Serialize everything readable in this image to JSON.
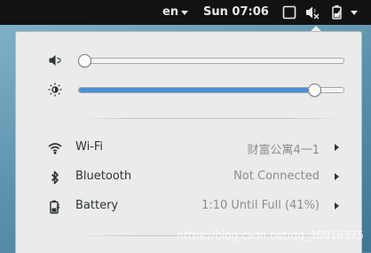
{
  "topbar": {
    "language": "en",
    "clock": "Sun 07:06",
    "icons": [
      "screen-icon",
      "volume-muted-icon",
      "battery-charging-icon",
      "chevron-down-icon"
    ]
  },
  "menu": {
    "volume": {
      "icon": "volume-muted-icon",
      "level": 0.0
    },
    "brightness": {
      "icon": "brightness-icon",
      "level": 0.87
    },
    "items": [
      {
        "icon": "wifi-icon",
        "label": "Wi-Fi",
        "status": "财富公寓4一1"
      },
      {
        "icon": "bluetooth-icon",
        "label": "Bluetooth",
        "status": "Not Connected"
      },
      {
        "icon": "battery-icon",
        "label": "Battery",
        "status": "1:10 Until Full (41%)"
      }
    ]
  },
  "watermark": "https://blog.csdn.net/qq_36016375",
  "colors": {
    "accent": "#4a90d9",
    "topbar": "#121212",
    "menu_bg": "#ebebeb"
  }
}
